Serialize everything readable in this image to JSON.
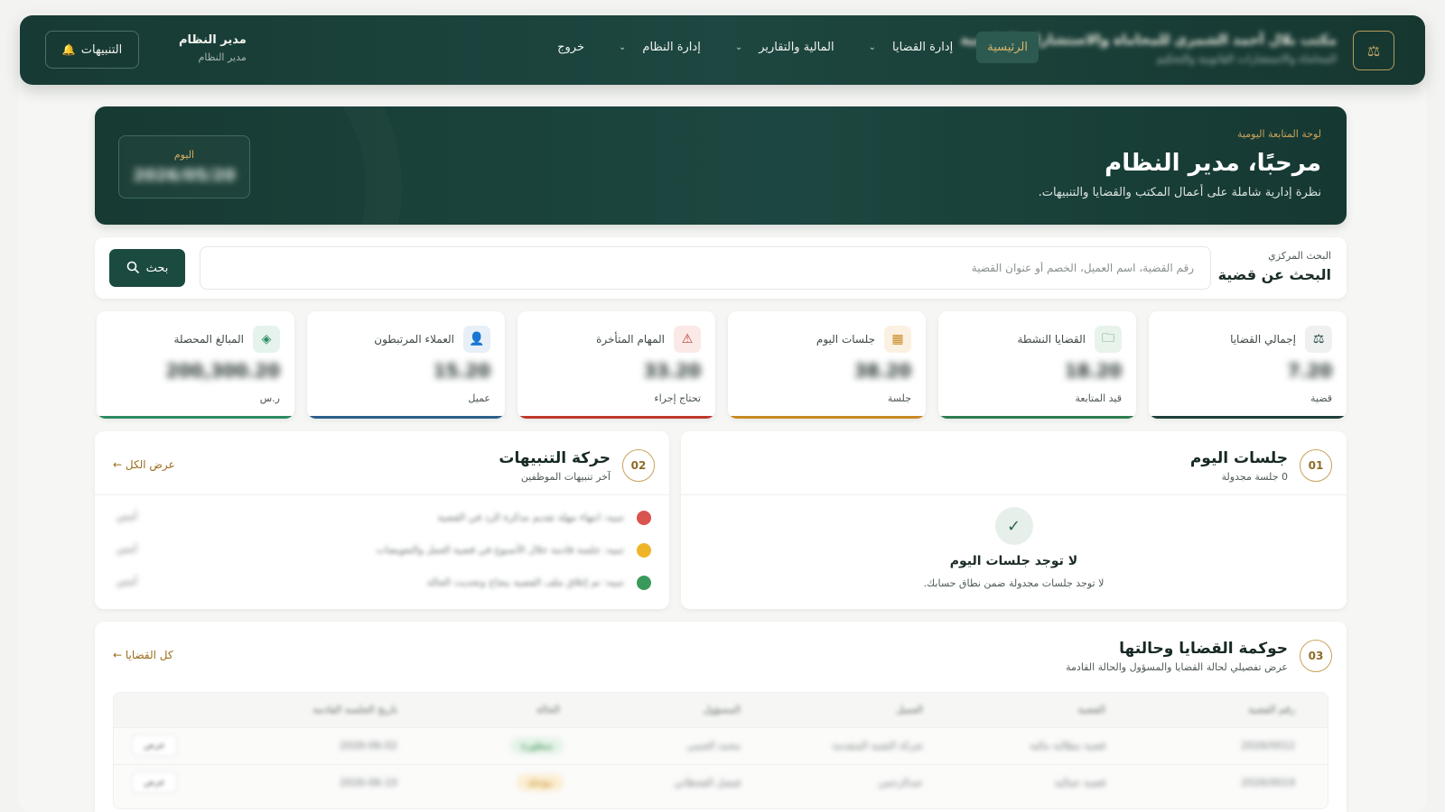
{
  "nav": {
    "brand_title": "مكتب بلال أحمد الشمري للمحاماة والاستشارات القانونية",
    "brand_sub": "المحاماة والاستشارات القانونية والتحكيم",
    "items": [
      {
        "label": "الرئيسية",
        "active": true,
        "has_chevron": false
      },
      {
        "label": "إدارة القضايا",
        "active": false,
        "has_chevron": true
      },
      {
        "label": "المالية والتقارير",
        "active": false,
        "has_chevron": true
      },
      {
        "label": "إدارة النظام",
        "active": false,
        "has_chevron": true
      },
      {
        "label": "خروج",
        "active": false,
        "has_chevron": false
      }
    ],
    "user_name": "مدير النظام",
    "user_role": "مدير النظام",
    "notifications_label": "التنبيهات"
  },
  "hero": {
    "kicker": "لوحة المتابعة اليومية",
    "title": "مرحبًا، مدير النظام",
    "subtitle": "نظرة إدارية شاملة على أعمال المكتب والقضايا والتنبيهات.",
    "date_label": "اليوم",
    "date_value": "2026/05/20"
  },
  "search": {
    "kicker": "البحث المركزي",
    "title": "البحث عن قضية",
    "placeholder": "رقم القضية، اسم العميل، الخصم أو عنوان القضية",
    "button_label": "بحث"
  },
  "stats": [
    {
      "label": "إجمالي القضايا",
      "value": "7.20",
      "unit": "قضية",
      "icon": "scales-icon",
      "color": "#1d3f39",
      "bg": "#eef1f0"
    },
    {
      "label": "القضايا النشطة",
      "value": "18.20",
      "unit": "قيد المتابعة",
      "icon": "folder-icon",
      "color": "#2e7d4f",
      "bg": "#e8f3ec"
    },
    {
      "label": "جلسات اليوم",
      "value": "38.20",
      "unit": "جلسة",
      "icon": "calendar-icon",
      "color": "#c98a22",
      "bg": "#fbf1e2"
    },
    {
      "label": "المهام المتأخرة",
      "value": "33.20",
      "unit": "تحتاج إجراء",
      "icon": "alert-icon",
      "color": "#c0392b",
      "bg": "#fbe9e7"
    },
    {
      "label": "العملاء المرتبطون",
      "value": "15.20",
      "unit": "عميل",
      "icon": "user-icon",
      "color": "#2c5f8a",
      "bg": "#e7eff7"
    },
    {
      "label": "المبالغ المحصلة",
      "value": "200,300.20",
      "unit": "ر.س",
      "icon": "money-icon",
      "color": "#2e8a62",
      "bg": "#e6f3ed"
    }
  ],
  "sessions_panel": {
    "number": "01",
    "title": "جلسات اليوم",
    "subtitle": "0 جلسة مجدولة",
    "empty_title": "لا توجد جلسات اليوم",
    "empty_sub": "لا توجد جلسات مجدولة ضمن نطاق حسابك."
  },
  "alerts_panel": {
    "number": "02",
    "title": "حركة التنبيهات",
    "subtitle": "آخر تنبيهات الموظفين",
    "link": "عرض الكل ←",
    "rows": [
      {
        "text": "تنبيه: انتهاء مهلة تقديم مذكرة الرد في القضية",
        "time": "أمس",
        "color": "#d9534f"
      },
      {
        "text": "تنبيه: جلسة قادمة خلال الأسبوع في قضية العمل والتعويضات",
        "time": "أمس",
        "color": "#f0b429"
      },
      {
        "text": "تنبيه: تم إغلاق ملف القضية بنجاح وتحديث الحالة",
        "time": "أمس",
        "color": "#3a9a5b"
      }
    ]
  },
  "cases_panel": {
    "number": "03",
    "title": "حوكمة القضايا وحالتها",
    "subtitle": "عرض تفصيلي لحالة القضايا والمسؤول والحالة القادمة",
    "link": "كل القضايا ←",
    "columns": [
      "رقم القضية",
      "القضية",
      "العميل",
      "المسؤول",
      "الحالة",
      "تاريخ الجلسة القادمة"
    ],
    "rows": [
      {
        "id": "2026/0012",
        "case": "قضية مطالبة مالية",
        "client": "شركة التقنية المتقدمة",
        "owner": "محمد العتيبي",
        "status": "منظورة",
        "status_color": "green",
        "date": "2026-06-02",
        "action": "عرض"
      },
      {
        "id": "2026/0019",
        "case": "قضية عمالية",
        "client": "عبدالرحمن",
        "owner": "فيصل القحطاني",
        "status": "مؤجلة",
        "status_color": "amber",
        "date": "2026-06-10",
        "action": "عرض"
      }
    ]
  }
}
